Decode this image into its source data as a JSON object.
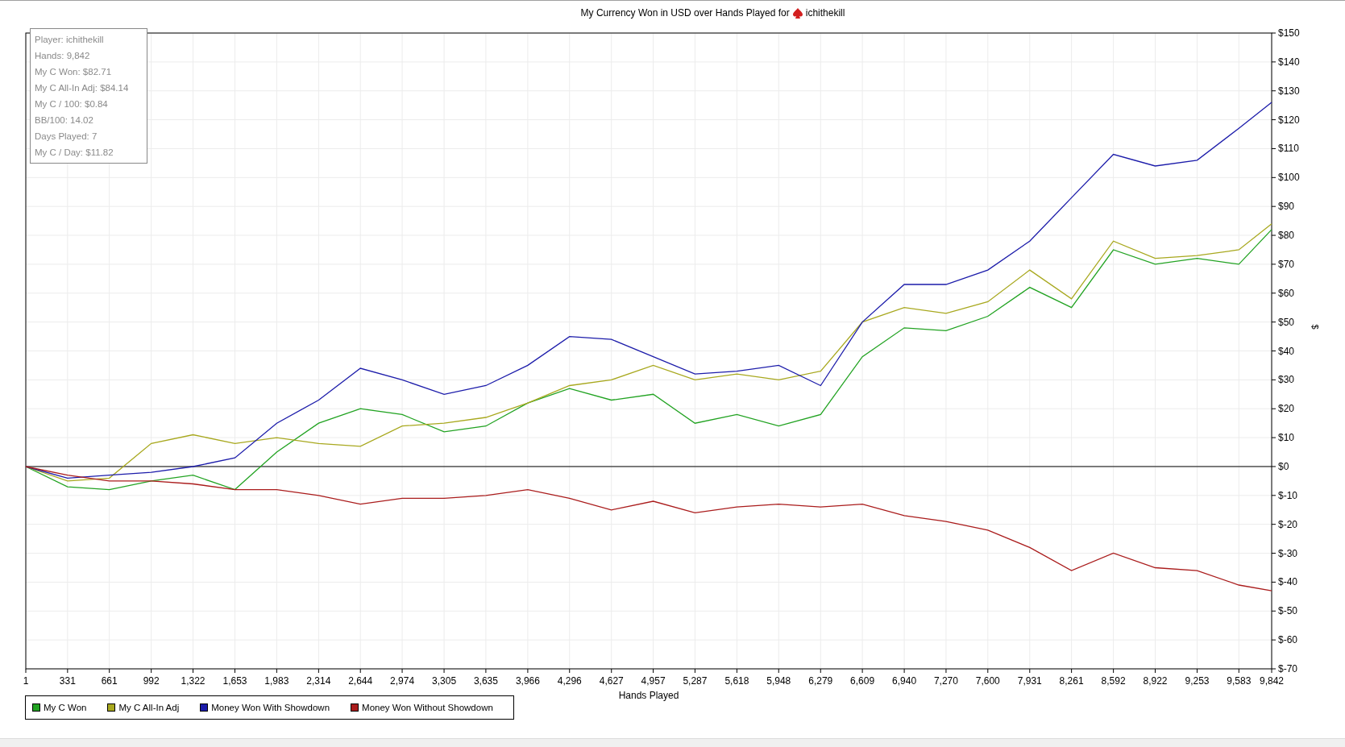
{
  "title": {
    "text": "My Currency Won in USD over Hands Played for",
    "player": "ichithekill"
  },
  "stats": [
    "Player: ichithekill",
    "Hands: 9,842",
    "My C Won: $82.71",
    "My C All-In Adj: $84.14",
    "My C / 100: $0.84",
    "BB/100: 14.02",
    "Days Played: 7",
    "My C / Day: $11.82"
  ],
  "chart_data": {
    "type": "line",
    "grid": true,
    "xlabel": "Hands Played",
    "ylabel": "$",
    "x": [
      1,
      331,
      661,
      992,
      1322,
      1653,
      1983,
      2314,
      2644,
      2974,
      3305,
      3635,
      3966,
      4296,
      4627,
      4957,
      5287,
      5618,
      5948,
      6279,
      6609,
      6940,
      7270,
      7600,
      7931,
      8261,
      8592,
      8922,
      9253,
      9583,
      9842
    ],
    "series": [
      {
        "name": "My C Won",
        "color": "#22a322",
        "values": [
          0,
          -7,
          -8,
          -5,
          -3,
          -8,
          5,
          15,
          20,
          18,
          12,
          14,
          22,
          27,
          23,
          25,
          15,
          18,
          14,
          18,
          38,
          48,
          47,
          52,
          62,
          55,
          75,
          70,
          72,
          70,
          82
        ]
      },
      {
        "name": "My C All-In Adj",
        "color": "#a8a81e",
        "values": [
          0,
          -5,
          -4,
          8,
          11,
          8,
          10,
          8,
          7,
          14,
          15,
          17,
          22,
          28,
          30,
          35,
          30,
          32,
          30,
          33,
          50,
          55,
          53,
          57,
          68,
          58,
          78,
          72,
          73,
          75,
          84
        ]
      },
      {
        "name": "Money Won With Showdown",
        "color": "#1c1caa",
        "values": [
          0,
          -4,
          -3,
          -2,
          0,
          3,
          15,
          23,
          34,
          30,
          25,
          28,
          35,
          45,
          44,
          38,
          32,
          33,
          35,
          28,
          50,
          63,
          63,
          68,
          78,
          93,
          108,
          104,
          106,
          117,
          126
        ]
      },
      {
        "name": "Money Won Without Showdown",
        "color": "#aa1c1c",
        "values": [
          0,
          -3,
          -5,
          -5,
          -6,
          -8,
          -8,
          -10,
          -13,
          -11,
          -11,
          -10,
          -8,
          -11,
          -15,
          -12,
          -16,
          -14,
          -13,
          -14,
          -13,
          -17,
          -19,
          -22,
          -28,
          -36,
          -30,
          -35,
          -36,
          -41,
          -43
        ]
      }
    ],
    "xlim": [
      1,
      9842
    ],
    "ylim": [
      -70,
      150
    ],
    "xticks": [
      {
        "value": 1,
        "label": "1"
      },
      {
        "value": 331,
        "label": "331"
      },
      {
        "value": 661,
        "label": "661"
      },
      {
        "value": 992,
        "label": "992"
      },
      {
        "value": 1322,
        "label": "1,322"
      },
      {
        "value": 1653,
        "label": "1,653"
      },
      {
        "value": 1983,
        "label": "1,983"
      },
      {
        "value": 2314,
        "label": "2,314"
      },
      {
        "value": 2644,
        "label": "2,644"
      },
      {
        "value": 2974,
        "label": "2,974"
      },
      {
        "value": 3305,
        "label": "3,305"
      },
      {
        "value": 3635,
        "label": "3,635"
      },
      {
        "value": 3966,
        "label": "3,966"
      },
      {
        "value": 4296,
        "label": "4,296"
      },
      {
        "value": 4627,
        "label": "4,627"
      },
      {
        "value": 4957,
        "label": "4,957"
      },
      {
        "value": 5287,
        "label": "5,287"
      },
      {
        "value": 5618,
        "label": "5,618"
      },
      {
        "value": 5948,
        "label": "5,948"
      },
      {
        "value": 6279,
        "label": "6,279"
      },
      {
        "value": 6609,
        "label": "6,609"
      },
      {
        "value": 6940,
        "label": "6,940"
      },
      {
        "value": 7270,
        "label": "7,270"
      },
      {
        "value": 7600,
        "label": "7,600"
      },
      {
        "value": 7931,
        "label": "7,931"
      },
      {
        "value": 8261,
        "label": "8,261"
      },
      {
        "value": 8592,
        "label": "8,592"
      },
      {
        "value": 8922,
        "label": "8,922"
      },
      {
        "value": 9253,
        "label": "9,253"
      },
      {
        "value": 9583,
        "label": "9,583"
      },
      {
        "value": 9842,
        "label": "9,842"
      }
    ],
    "yticks": [
      {
        "value": 150,
        "label": "$150"
      },
      {
        "value": 140,
        "label": "$140"
      },
      {
        "value": 130,
        "label": "$130"
      },
      {
        "value": 120,
        "label": "$120"
      },
      {
        "value": 110,
        "label": "$110"
      },
      {
        "value": 100,
        "label": "$100"
      },
      {
        "value": 90,
        "label": "$90"
      },
      {
        "value": 80,
        "label": "$80"
      },
      {
        "value": 70,
        "label": "$70"
      },
      {
        "value": 60,
        "label": "$60"
      },
      {
        "value": 50,
        "label": "$50"
      },
      {
        "value": 40,
        "label": "$40"
      },
      {
        "value": 30,
        "label": "$30"
      },
      {
        "value": 20,
        "label": "$20"
      },
      {
        "value": 10,
        "label": "$10"
      },
      {
        "value": 0,
        "label": "$0"
      },
      {
        "value": -10,
        "label": "$-10"
      },
      {
        "value": -20,
        "label": "$-20"
      },
      {
        "value": -30,
        "label": "$-30"
      },
      {
        "value": -40,
        "label": "$-40"
      },
      {
        "value": -50,
        "label": "$-50"
      },
      {
        "value": -60,
        "label": "$-60"
      },
      {
        "value": -70,
        "label": "$-70"
      }
    ]
  }
}
